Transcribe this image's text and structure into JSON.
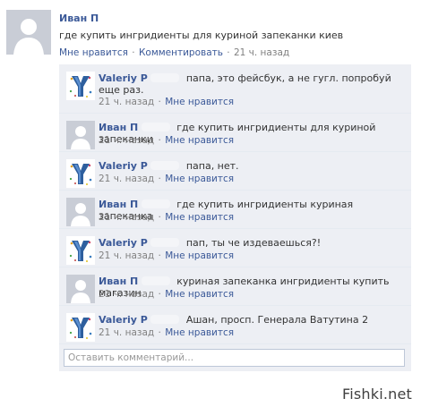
{
  "post": {
    "author": "Иван П",
    "text": "где купить ингридиенты для куриной запеканки киев",
    "like": "Мне нравится",
    "comment": "Комментировать",
    "time": "21 ч. назад",
    "sep": "·"
  },
  "comments": [
    {
      "author": "Valeriy P",
      "text": "папа, это фейсбук, а не гугл. попробуй еще раз.",
      "time": "21 ч. назад",
      "like": "Мне нравится",
      "sep": "·"
    },
    {
      "author": "Иван П",
      "text": "где купить ингридиенты для куриной запеканки",
      "time": "21 ч. назад",
      "like": "Мне нравится",
      "sep": "·"
    },
    {
      "author": "Valeriy P",
      "text": "папа, нет.",
      "time": "21 ч. назад",
      "like": "Мне нравится",
      "sep": "·"
    },
    {
      "author": "Иван П",
      "text": "где купить ингридиенты куриная запеканка",
      "time": "21 ч. назад",
      "like": "Мне нравится",
      "sep": "·"
    },
    {
      "author": "Valeriy P",
      "text": "пап, ты че издеваешься?!",
      "time": "21 ч. назад",
      "like": "Мне нравится",
      "sep": "·"
    },
    {
      "author": "Иван П",
      "text": "куриная запеканка ингридиенты купить магазин",
      "time": "21 ч. назад",
      "like": "Мне нравится",
      "sep": "·"
    },
    {
      "author": "Valeriy P",
      "text": "Ашан,  просп. Генерала Ватутина 2",
      "time": "21 ч. назад",
      "like": "Мне нравится",
      "sep": "·"
    }
  ],
  "comment_input": {
    "placeholder": "Оставить комментарий..."
  },
  "watermark": "Fishki.net",
  "icons": {
    "avatar_default": "default-profile-silhouette-icon",
    "avatar_valeriy": "y-logo-avatar-icon"
  },
  "colors": {
    "link": "#3b5998",
    "comment_bg": "#edeff4",
    "meta": "#808080"
  }
}
